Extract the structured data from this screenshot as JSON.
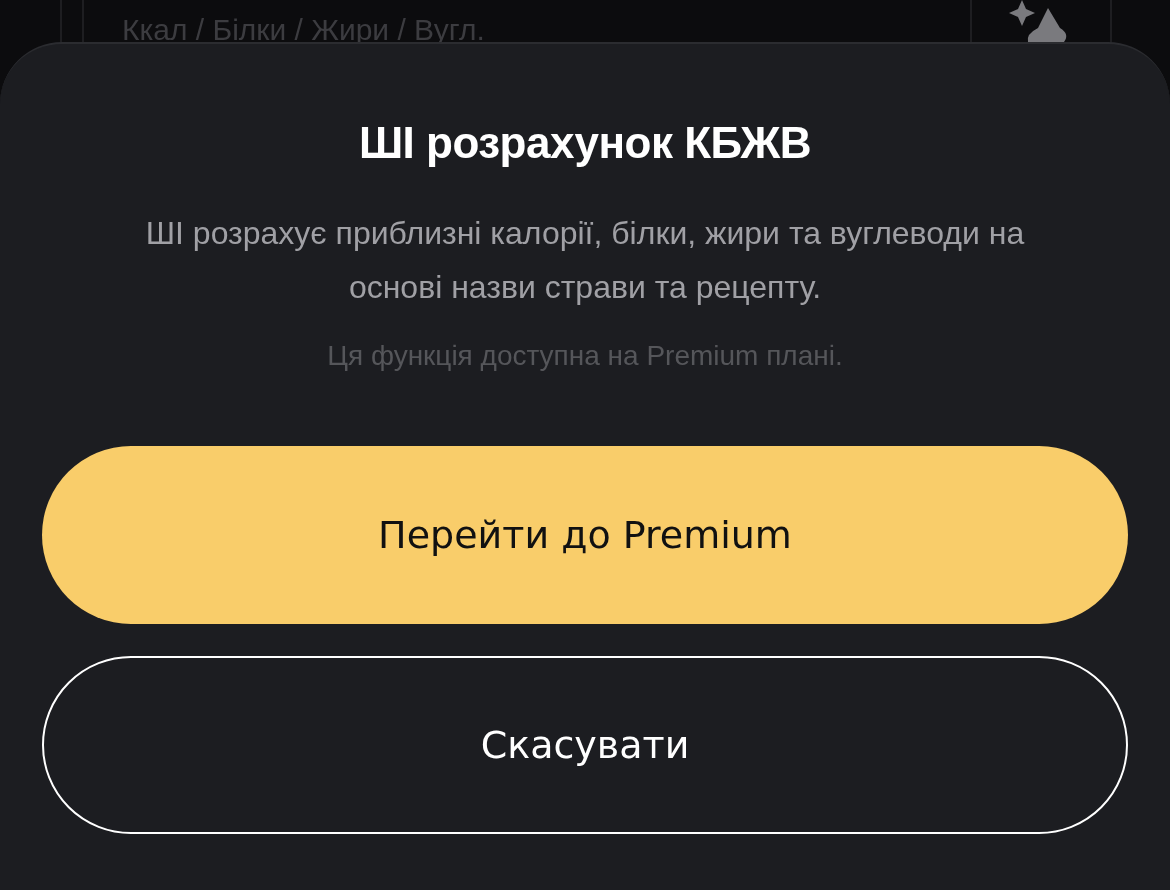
{
  "background_field": {
    "placeholder": "Ккал / Білки / Жири / Вугл."
  },
  "dialog": {
    "title": "ШІ розрахунок КБЖВ",
    "description": "ШІ розрахує приблизні калорії, білки, жири та вуглеводи на основі назви страви та рецепту.",
    "note": "Ця функція доступна на Premium плані.",
    "buttons": [
      {
        "label": "Перейти до Premium",
        "kind": "primary"
      },
      {
        "label": "Скасувати",
        "kind": "secondary"
      }
    ]
  }
}
